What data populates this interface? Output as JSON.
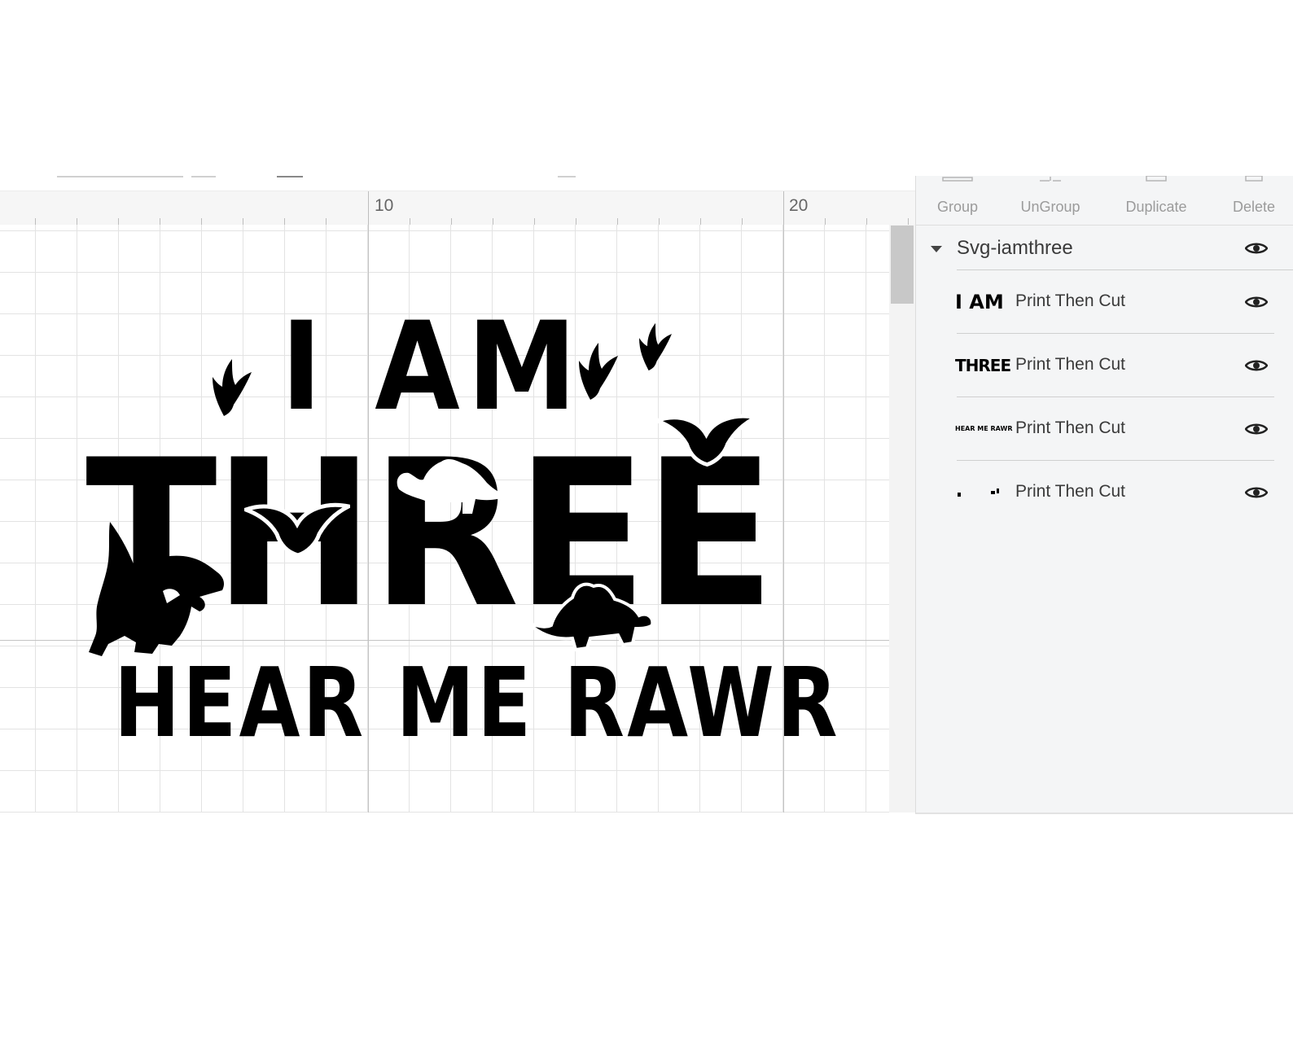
{
  "ruler": {
    "ticks": [
      "10",
      "20"
    ]
  },
  "design": {
    "line1": "I AM",
    "line2": "THREE",
    "line3": "HEAR ME RAWR"
  },
  "toolbar": {
    "group_label": "Group",
    "ungroup_label": "UnGroup",
    "duplicate_label": "Duplicate",
    "delete_label": "Delete"
  },
  "layers": {
    "group_name": "Svg-iamthree",
    "items": [
      {
        "thumb_text": "I AM",
        "label": "Print Then Cut"
      },
      {
        "thumb_text": "THREE",
        "label": "Print Then Cut"
      },
      {
        "thumb_text": "HEAR ME RAWR",
        "label": "Print Then Cut"
      },
      {
        "thumb_text": "",
        "label": "Print Then Cut"
      }
    ]
  },
  "icons": {
    "visibility": "eye-icon",
    "expand": "caret-down-icon",
    "group": "group-icon",
    "ungroup": "ungroup-icon",
    "duplicate": "duplicate-icon",
    "delete": "delete-icon"
  },
  "colors": {
    "panel_bg": "#f4f5f6",
    "design_ink": "#000000",
    "toolbar_text": "#9b9b9b",
    "layer_text": "#3a3a3a"
  }
}
